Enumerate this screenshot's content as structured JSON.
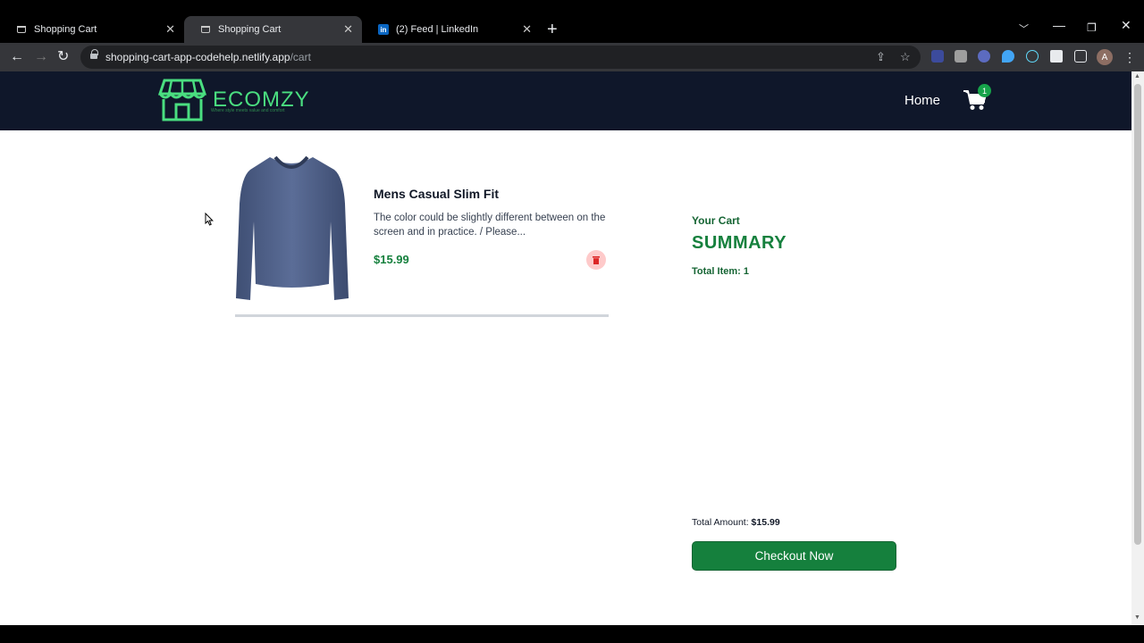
{
  "browser": {
    "tabs": [
      {
        "title": "Shopping Cart",
        "icon": "cart-icon",
        "active": false
      },
      {
        "title": "Shopping Cart",
        "icon": "cart-icon",
        "active": true
      },
      {
        "title": "(2) Feed | LinkedIn",
        "icon": "linkedin-icon",
        "active": false
      }
    ],
    "new_tab": "+",
    "address": {
      "host": "shopping-cart-app-codehelp.netlify.app",
      "path": "/cart"
    },
    "avatar_initial": "A",
    "linkedin_letters": "in"
  },
  "site": {
    "logo_text": "ECOMZY",
    "logo_tagline": "Where style meets value and comfort",
    "nav": {
      "home": "Home",
      "cart_count": "1"
    },
    "colors": {
      "navbar": "#0f172a",
      "accent": "#15803d",
      "logo": "#4ade80"
    }
  },
  "cart": {
    "items": [
      {
        "title": "Mens Casual Slim Fit",
        "description": "The color could be slightly different between on the screen and in practice. / Please...",
        "price": "$15.99"
      }
    ]
  },
  "summary": {
    "label": "Your Cart",
    "title": "SUMMARY",
    "total_items": "Total Item: 1",
    "total_amount_label": "Total Amount:",
    "total_amount_value": "$15.99",
    "checkout_label": "Checkout Now"
  }
}
